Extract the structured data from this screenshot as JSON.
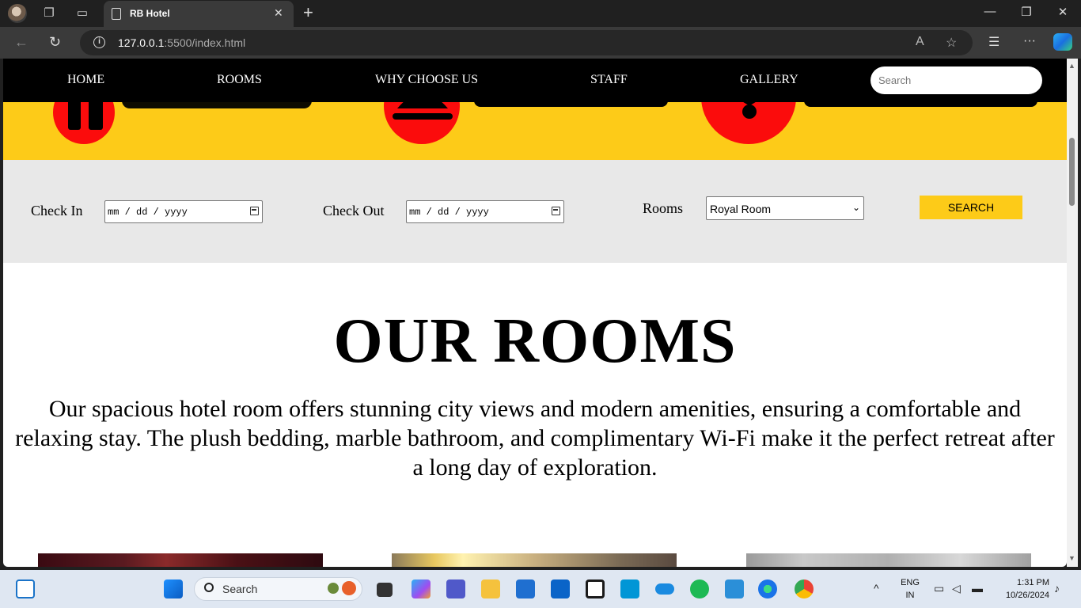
{
  "browser": {
    "tab_title": "RB Hotel",
    "url_host": "127.0.0.1",
    "url_path": ":5500/index.html"
  },
  "nav": {
    "links": [
      "HOME",
      "ROOMS",
      "WHY CHOOSE US",
      "STAFF",
      "GALLERY"
    ],
    "search_placeholder": "Search"
  },
  "features": {
    "colors": {
      "band": "#fdcb18",
      "circle": "#fb0c0c"
    }
  },
  "booking": {
    "check_in_label": "Check In",
    "check_in_value": "mm / dd / yyyy",
    "check_out_label": "Check Out",
    "check_out_value": "mm / dd / yyyy",
    "rooms_label": "Rooms",
    "rooms_selected": "Royal Room",
    "search_button": "SEARCH"
  },
  "rooms_section": {
    "title": "OUR ROOMS",
    "description": "Our spacious hotel room offers stunning city views and modern amenities, ensuring a comfortable and relaxing stay. The plush bedding, marble bathroom, and complimentary Wi-Fi make it the perfect retreat after a long day of exploration."
  },
  "taskbar": {
    "search_label": "Search",
    "language": "ENG",
    "region": "IN",
    "time": "1:31 PM",
    "date": "10/26/2024"
  }
}
